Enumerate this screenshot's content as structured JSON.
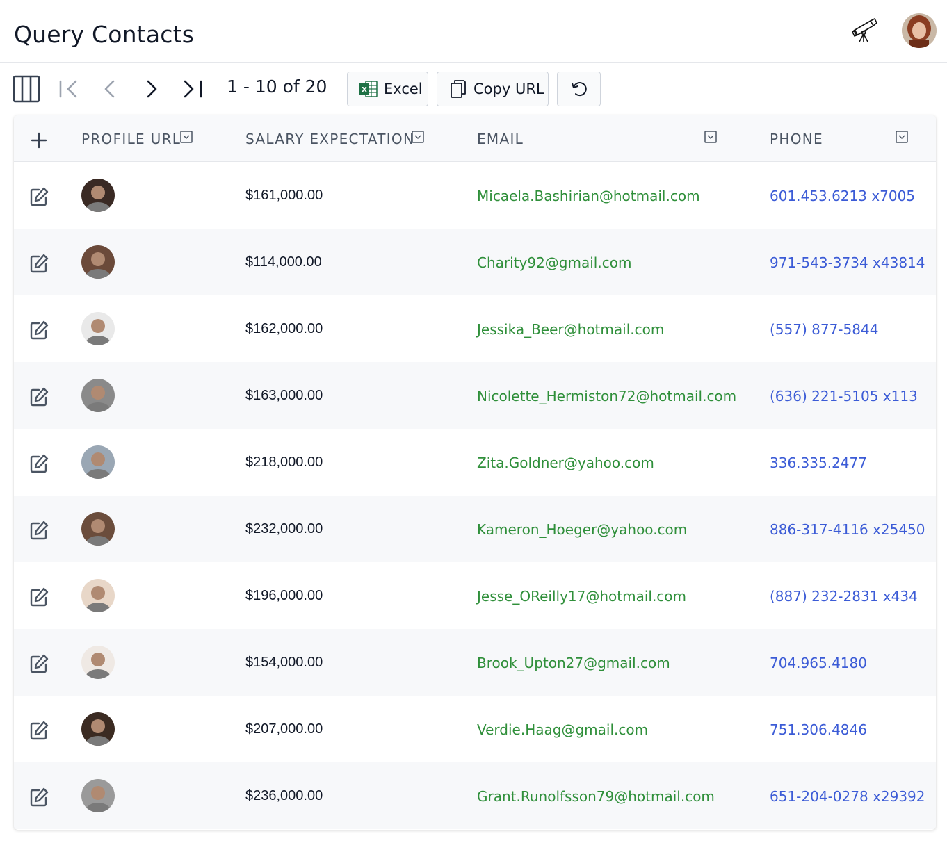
{
  "header": {
    "title": "Query Contacts",
    "telescope_icon": "telescope-icon",
    "user_avatar_icon": "user-avatar"
  },
  "toolbar": {
    "pager_text": "1 - 10 of 20",
    "excel_label": "Excel",
    "copy_url_label": "Copy URL",
    "icons": [
      "columns-icon",
      "first-page-icon",
      "prev-page-icon",
      "next-page-icon",
      "last-page-icon",
      "excel-icon",
      "copy-icon",
      "reset-icon"
    ]
  },
  "grid": {
    "columns": [
      "PROFILE URL",
      "SALARY EXPECTATION",
      "EMAIL",
      "PHONE"
    ],
    "rows": [
      {
        "salary": "$161,000.00",
        "email": "Micaela.Bashirian@hotmail.com",
        "phone": "601.453.6213 x7005",
        "avatar_color": "#3a2a24"
      },
      {
        "salary": "$114,000.00",
        "email": "Charity92@gmail.com",
        "phone": "971-543-3734 x43814",
        "avatar_color": "#6b4a3a"
      },
      {
        "salary": "$162,000.00",
        "email": "Jessika_Beer@hotmail.com",
        "phone": "(557) 877-5844",
        "avatar_color": "#e9e9e9"
      },
      {
        "salary": "$163,000.00",
        "email": "Nicolette_Hermiston72@hotmail.com",
        "phone": "(636) 221-5105 x113",
        "avatar_color": "#8a8a8a"
      },
      {
        "salary": "$218,000.00",
        "email": "Zita.Goldner@yahoo.com",
        "phone": "336.335.2477",
        "avatar_color": "#9aa7b4"
      },
      {
        "salary": "$232,000.00",
        "email": "Kameron_Hoeger@yahoo.com",
        "phone": "886-317-4116 x25450",
        "avatar_color": "#6b4d3c"
      },
      {
        "salary": "$196,000.00",
        "email": "Jesse_OReilly17@hotmail.com",
        "phone": "(887) 232-2831 x434",
        "avatar_color": "#e8d7c8"
      },
      {
        "salary": "$154,000.00",
        "email": "Brook_Upton27@gmail.com",
        "phone": "704.965.4180",
        "avatar_color": "#efe9e4"
      },
      {
        "salary": "$207,000.00",
        "email": "Verdie.Haag@gmail.com",
        "phone": "751.306.4846",
        "avatar_color": "#3b2b22"
      },
      {
        "salary": "$236,000.00",
        "email": "Grant.Runolfsson79@hotmail.com",
        "phone": "651-204-0278 x29392",
        "avatar_color": "#9a9a9a"
      }
    ]
  },
  "colors": {
    "email": "#2f8f3a",
    "phone": "#3b5bd6",
    "row_alt": "#f7f8fa",
    "excel_green": "#1e7145"
  }
}
